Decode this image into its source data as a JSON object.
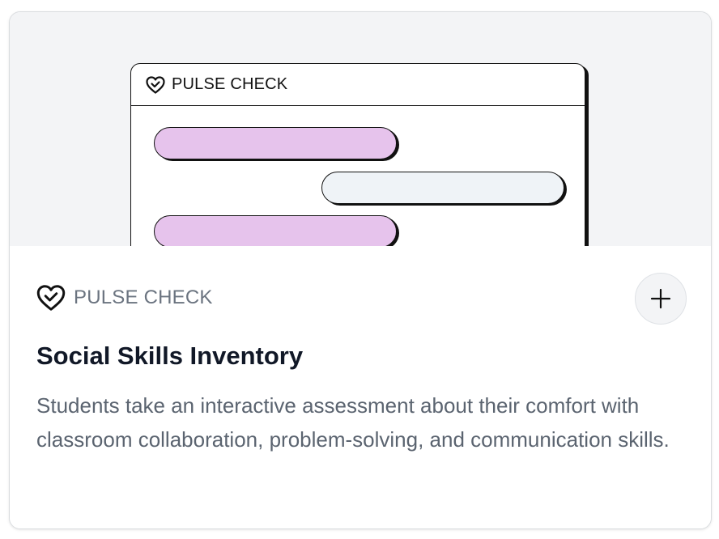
{
  "card": {
    "preview": {
      "window_title": "PULSE CHECK",
      "icon": "heart-check-icon",
      "bubble_colors": {
        "purple": "#e6c3ec",
        "light": "#eff3f7"
      }
    },
    "tag": {
      "label": "PULSE CHECK",
      "icon": "heart-check-icon"
    },
    "add_button": {
      "icon": "plus-icon"
    },
    "title": "Social Skills Inventory",
    "description": "Students take an interactive assessment about their comfort with classroom collaboration, problem-solving, and communication skills."
  }
}
